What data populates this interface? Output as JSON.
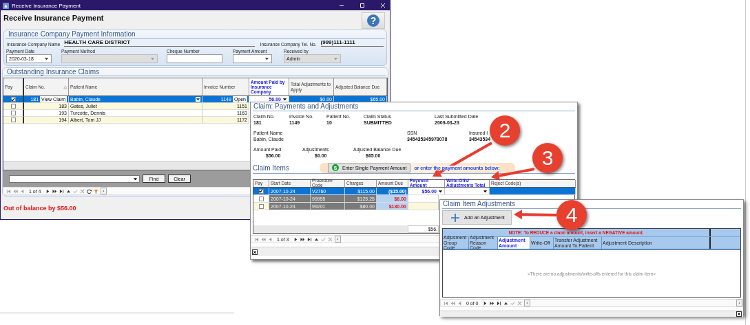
{
  "main_window": {
    "title": "Receive Insurance Payment",
    "heading": "Receive Insurance Payment",
    "help_button": "?",
    "payment_info": {
      "title": "Insurance Company Payment Information",
      "company_name_label": "Insurance Company Name",
      "company_name": "HEALTH CARE DISTRICT",
      "tel_label": "Insurance Company Tel. No.",
      "tel": "(999)111-1111",
      "fields": [
        {
          "label": "Payment Date",
          "value": "2020-03-18",
          "kind": "dropdown",
          "disabled": false
        },
        {
          "label": "Payment Method",
          "kind": "dropdown",
          "disabled": true
        },
        {
          "label": "Cheque Number",
          "kind": "text",
          "disabled": false
        },
        {
          "label": "Payment Amount",
          "kind": "dropdown",
          "disabled": false
        },
        {
          "label": "Received by",
          "value": "Admin",
          "kind": "dropdown",
          "disabled": true
        }
      ]
    },
    "claims": {
      "title": "Outstanding Insurance Claims",
      "columns": [
        {
          "label": "Pay",
          "editable": false,
          "sorted": false
        },
        {
          "label": "Claim No.",
          "editable": false,
          "sorted": true
        },
        {
          "label": "Patient Name",
          "editable": false,
          "sorted": false
        },
        {
          "label": "Invoice Number",
          "editable": false,
          "sorted": false
        },
        {
          "label": "Amount Paid by Insurance Company",
          "editable": true,
          "sorted": false
        },
        {
          "label": "Total Adjustments to Apply",
          "editable": false,
          "sorted": false
        },
        {
          "label": "Adjusted Balance Due",
          "editable": false,
          "sorted": false
        }
      ],
      "rows": [
        {
          "selected": true,
          "checked": true,
          "claim_no": "181",
          "view_button": "View Claim",
          "patient": "Babin, Claude",
          "invoice": "1149",
          "open_button": "Open",
          "amount_paid": "56.00",
          "total_adjustments": "$0.00",
          "balance": "$65.00"
        },
        {
          "selected": false,
          "checked": false,
          "claim_no": "183",
          "patient": "Gates, Juliet",
          "invoice": "1151"
        },
        {
          "selected": false,
          "checked": false,
          "claim_no": "193",
          "patient": "Turcotte, Dennis",
          "invoice": "1163"
        },
        {
          "selected": false,
          "checked": false,
          "claim_no": "194",
          "patient": "Albert, Tom JJ",
          "invoice": "1172"
        }
      ],
      "find_button": "Find",
      "clear_button": "Clear",
      "pager": "1 of 4"
    },
    "status": "Out of balance by $56.00"
  },
  "claim_window": {
    "title": "Claim:  Payments and Adjustments",
    "summary_rows": [
      [
        {
          "label": "Claim No.",
          "value": "181"
        },
        {
          "label": "Invoice No.",
          "value": "1149"
        },
        {
          "label": "Patient No.",
          "value": "10"
        },
        {
          "label": "Claim Status",
          "value": "SUBMITTED"
        },
        {
          "label": "Last Submitted Date",
          "value": "2009-03-23"
        }
      ],
      [
        {
          "label": "Patient Name",
          "value": "Babin, Claude"
        },
        {
          "label": "SSN",
          "value": "345435345978078"
        },
        {
          "label": "Insured I",
          "value": "34543534"
        }
      ],
      [
        {
          "label": "Amount Paid",
          "value": "$56.00"
        },
        {
          "label": "Adjustments",
          "value": "$0.00"
        },
        {
          "label": "Adjusted Balance Due",
          "value": "$65.00"
        }
      ]
    ],
    "items_title": "Claim Items",
    "dollar_symbol": "$",
    "single_payment_button": "Enter Single Payment Amount",
    "payment_hint": "or enter the payment amounts below:",
    "columns": [
      {
        "label": "Pay",
        "editable": false
      },
      {
        "label": "Start Date",
        "editable": false
      },
      {
        "label": "Procedure Code",
        "editable": false
      },
      {
        "label": "Charges",
        "editable": false
      },
      {
        "label": "Amount Due",
        "editable": false
      },
      {
        "label": "Payment Amount",
        "editable": true
      },
      {
        "label": "Write-Offs/ Adjustments Total",
        "editable": true
      },
      {
        "label": "Reject Code(s)",
        "editable": false
      }
    ],
    "rows": [
      {
        "selected": true,
        "checked": true,
        "start_date": "2007-10-24",
        "procedure_code": "V2760",
        "charges": "$115.00",
        "amount_due": "($15.00)",
        "payment_amount": "$56.00"
      },
      {
        "selected": false,
        "checked": false,
        "start_date": "2007-10-24",
        "procedure_code": "99955",
        "charges": "$125.25",
        "amount_due": "$6.00"
      },
      {
        "selected": false,
        "checked": false,
        "start_date": "2007-10-24",
        "procedure_code": "99201",
        "charges": "$80.00",
        "amount_due": "$130.00"
      }
    ],
    "total": "$56.",
    "pager": "1 of 3"
  },
  "adjustments_window": {
    "title": "Claim Item Adjustments",
    "add_button": "Add an Adjustment",
    "note": "NOTE: To REDUCE a claim amount, insert a NEGATIVE amount.",
    "columns": [
      {
        "label": "Adjusment Group Code",
        "editable": false
      },
      {
        "label": "Adjustment Reason Code",
        "editable": false
      },
      {
        "label": "Adjustment Amount",
        "editable": true
      },
      {
        "label": "Write-Off",
        "editable": false
      },
      {
        "label": "Transfer Adjustment Amount To Patient",
        "editable": false
      },
      {
        "label": "Adjustment Description",
        "editable": false
      }
    ],
    "empty_message": "<There are no adjustments/write-offs entered for this claim item>",
    "pager": "0 of 0"
  },
  "callouts": [
    {
      "number": "2"
    },
    {
      "number": "3"
    },
    {
      "number": "4"
    }
  ]
}
